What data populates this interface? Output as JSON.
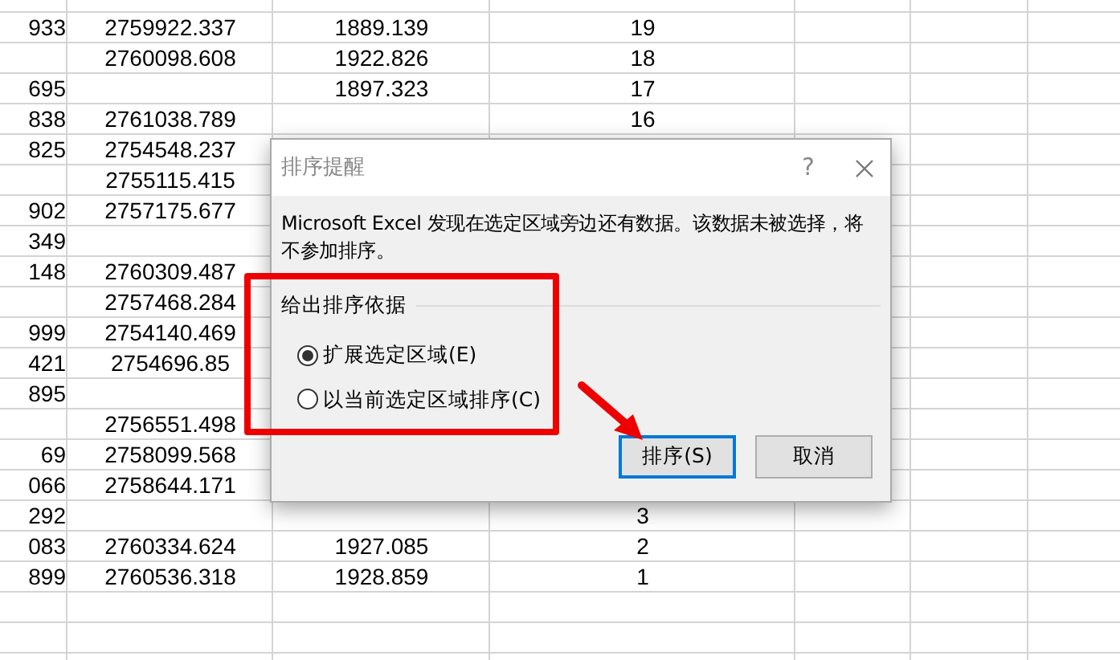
{
  "sheet": {
    "rows": [
      {
        "a": "933",
        "b": "2759922.337",
        "c": "1889.139",
        "d": "19"
      },
      {
        "a": "",
        "b": "2760098.608",
        "c": "1922.826",
        "d": "18"
      },
      {
        "a": "695",
        "b": "",
        "c": "1897.323",
        "d": "17"
      },
      {
        "a": "838",
        "b": "2761038.789",
        "c": "",
        "d": "16"
      },
      {
        "a": "825",
        "b": "2754548.237",
        "c": "",
        "d": ""
      },
      {
        "a": "",
        "b": "2755115.415",
        "c": "",
        "d": ""
      },
      {
        "a": "902",
        "b": "2757175.677",
        "c": "",
        "d": ""
      },
      {
        "a": "349",
        "b": "",
        "c": "",
        "d": ""
      },
      {
        "a": "148",
        "b": "2760309.487",
        "c": "",
        "d": ""
      },
      {
        "a": "",
        "b": "2757468.284",
        "c": "",
        "d": ""
      },
      {
        "a": "999",
        "b": "2754140.469",
        "c": "",
        "d": ""
      },
      {
        "a": "421",
        "b": "2754696.85",
        "c": "",
        "d": ""
      },
      {
        "a": "895",
        "b": "",
        "c": "",
        "d": ""
      },
      {
        "a": "",
        "b": "2756551.498",
        "c": "",
        "d": ""
      },
      {
        "a": "69",
        "b": "2758099.568",
        "c": "",
        "d": ""
      },
      {
        "a": "066",
        "b": "2758644.171",
        "c": "",
        "d": ""
      },
      {
        "a": "292",
        "b": "",
        "c": "",
        "d": "3"
      },
      {
        "a": "083",
        "b": "2760334.624",
        "c": "1927.085",
        "d": "2"
      },
      {
        "a": "899",
        "b": "2760536.318",
        "c": "1928.859",
        "d": "1"
      },
      {
        "a": "",
        "b": "",
        "c": "",
        "d": ""
      },
      {
        "a": "",
        "b": "",
        "c": "",
        "d": ""
      }
    ]
  },
  "dialog": {
    "title": "排序提醒",
    "help": "?",
    "message": "Microsoft Excel 发现在选定区域旁边还有数据。该数据未被选择，将不参加排序。",
    "group_label": "给出排序依据",
    "options": [
      {
        "label": "扩展选定区域(E)",
        "selected": true
      },
      {
        "label": "以当前选定区域排序(C)",
        "selected": false
      }
    ],
    "buttons": [
      {
        "label": "排序(S)",
        "default": true
      },
      {
        "label": "取消",
        "default": false
      }
    ]
  }
}
